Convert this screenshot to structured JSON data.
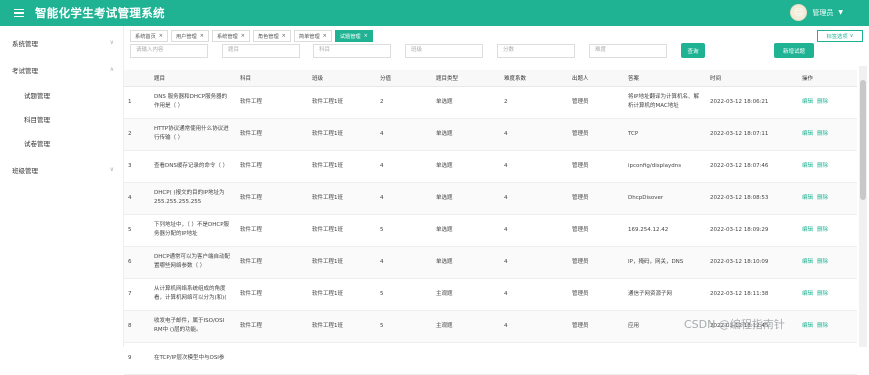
{
  "header": {
    "title": "智能化学生考试管理系统",
    "user": "管理员"
  },
  "sidebar": {
    "items": [
      {
        "label": "系统管理"
      },
      {
        "label": "考试管理"
      },
      {
        "label": "试题管理"
      },
      {
        "label": "科目管理"
      },
      {
        "label": "试卷管理"
      },
      {
        "label": "班级管理"
      }
    ]
  },
  "tabs": [
    {
      "label": "系统首页"
    },
    {
      "label": "用户管理"
    },
    {
      "label": "系统管理"
    },
    {
      "label": "角色管理"
    },
    {
      "label": "简单管理"
    },
    {
      "label": "试题管理"
    }
  ],
  "tab_options": "标签选项",
  "filters": [
    {
      "placeholder": "请输入内容"
    },
    {
      "placeholder": "题目"
    },
    {
      "placeholder": "科目"
    },
    {
      "placeholder": "班级"
    },
    {
      "placeholder": "分数"
    },
    {
      "placeholder": "难度"
    }
  ],
  "buttons": {
    "query": "查询",
    "add": "新增试题"
  },
  "table": {
    "columns": [
      "",
      "题目",
      "科目",
      "班级",
      "分值",
      "题目类型",
      "难度系数",
      "出题人",
      "答案",
      "时间",
      "操作"
    ],
    "rows": [
      [
        "1",
        "DNS 服务器和DHCP服务器的作用是（ ）",
        "软件工程",
        "软件工程1班",
        "2",
        "单选题",
        "2",
        "管理员",
        "将IP地址翻译为计算机名、解析计算机的MAC地址",
        "2022-03-12 18:06:21"
      ],
      [
        "2",
        "HTTP协议通常使用什么协议进行传输（ ）",
        "软件工程",
        "软件工程1班",
        "4",
        "单选题",
        "4",
        "管理员",
        "TCP",
        "2022-03-12 18:07:11"
      ],
      [
        "3",
        "查看DNS缓存记录的命令（ ）",
        "软件工程",
        "软件工程1班",
        "4",
        "单选题",
        "4",
        "管理员",
        "ipconfig/displaydns",
        "2022-03-12 18:07:46"
      ],
      [
        "4",
        "DHCP( )报文的目的IP地址为255.255.255.255",
        "软件工程",
        "软件工程1班",
        "4",
        "单选题",
        "4",
        "管理员",
        "DhcpDisover",
        "2022-03-12 18:08:53"
      ],
      [
        "5",
        "下列地址中，（ ）不是DHCP服务器分配的IP地址",
        "软件工程",
        "软件工程1班",
        "5",
        "单选题",
        "4",
        "管理员",
        "169.254.12.42",
        "2022-03-12 18:09:29"
      ],
      [
        "6",
        "DHCP通常可以为客户端自动配置哪些网络参数（ ）",
        "软件工程",
        "软件工程1班",
        "4",
        "单选题",
        "4",
        "管理员",
        "IP，掩码，网关，DNS",
        "2022-03-12 18:10:09"
      ],
      [
        "7",
        "从计算机网络系统组成的角度看，计算机网络可以分为(和)(",
        "软件工程",
        "软件工程1班",
        "5",
        "主观题",
        "4",
        "管理员",
        "通信子网资源子网",
        "2022-03-12 18:11:38"
      ],
      [
        "8",
        "收发电子邮件，属于ISO/OSI RM中 ()层的功能。",
        "软件工程",
        "软件工程1班",
        "5",
        "主观题",
        "4",
        "管理员",
        "应用",
        "2022-03-12 18:12:45"
      ],
      [
        "9",
        "在TCP/IP层次模型中与OSI参",
        "",
        "",
        "",
        "",
        "",
        "",
        "",
        ""
      ]
    ],
    "ops": {
      "edit": "编辑",
      "delete": "删除"
    }
  },
  "watermark": "CSDN @编程指南针"
}
